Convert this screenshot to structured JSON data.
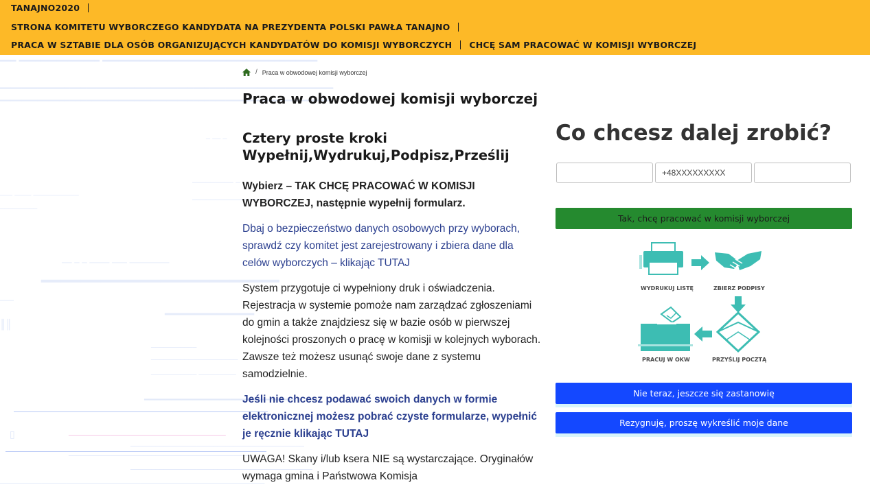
{
  "header": {
    "brand": "TANAJNO2020",
    "committee": "STRONA KOMITETU WYBORCZEGO KANDYDATA NA PREZYDENTA POLSKI PAWŁA TANAJNO",
    "staff_link": "PRACA W SZTABIE DLA OSÓB ORGANIZUJĄCYCH KANDYDATÓW DO KOMISJI WYBORCZYCH",
    "self_link": "CHCĘ SAM PRACOWAĆ W KOMISJI WYBORCZEJ"
  },
  "breadcrumb": {
    "current": "Praca w obwodowej komisji wyborczej"
  },
  "page_title": "Praca w obwodowej komisji wyborczej",
  "content": {
    "steps_line1": "Cztery proste kroki",
    "steps_line2": "Wypełnij,Wydrukuj,Podpisz,Prześlij",
    "lead": "Wybierz – TAK CHCĘ PRACOWAĆ W KOMISJI WYBORCZEJ, następnie wypełnij formularz.",
    "privacy_link": "Dbaj o bezpieczeństwo danych osobowych przy wyborach, sprawdź czy komitet jest zarejestrowany i zbiera dane dla celów wyborczych – klikając TUTAJ",
    "system_para": "System przygotuje ci wypełniony druk i oświadczenia. Rejestracja w systemie pomoże nam zarządzać zgłoszeniami do gmin a także znajdziesz się w bazie osób w pierwszej kolejności proszonych o pracę w komisji w kolejnych wyborach. Zawsze też możesz usunąć swoje dane z systemu samodzielnie.",
    "paper_link": "Jeśli nie chcesz podawać swoich danych w formie elektronicznej możesz pobrać czyste formularze, wypełnić je ręcznie klikając TUTAJ",
    "warning": "UWAGA! Skany i/lub ksera NIE są wystarczające. Oryginałów wymaga gmina i Państwowa Komisja"
  },
  "panel": {
    "title": "Co chcesz dalej zrobić?",
    "input1_value": "",
    "input2_value": "+48XXXXXXXXX",
    "input3_value": "",
    "yes_button": "Tak, chcę pracować w komisji wyborczej",
    "steps": {
      "print": "WYDRUKUJ LISTĘ",
      "sign": "ZBIERZ PODPISY",
      "work": "PRACUJ W OKW",
      "mail": "PRZYŚLIJ POCZTĄ"
    },
    "not_now_button": "Nie teraz, jeszcze się zastanowię",
    "resign_button": "Rezygnuję, proszę wykreślić moje dane"
  },
  "colors": {
    "header_bg": "#fdb927",
    "link_blue": "#2b3f8f",
    "green_button": "#258a2f",
    "blue_button": "#1448ff",
    "teal_icon": "#3dbdb3"
  }
}
